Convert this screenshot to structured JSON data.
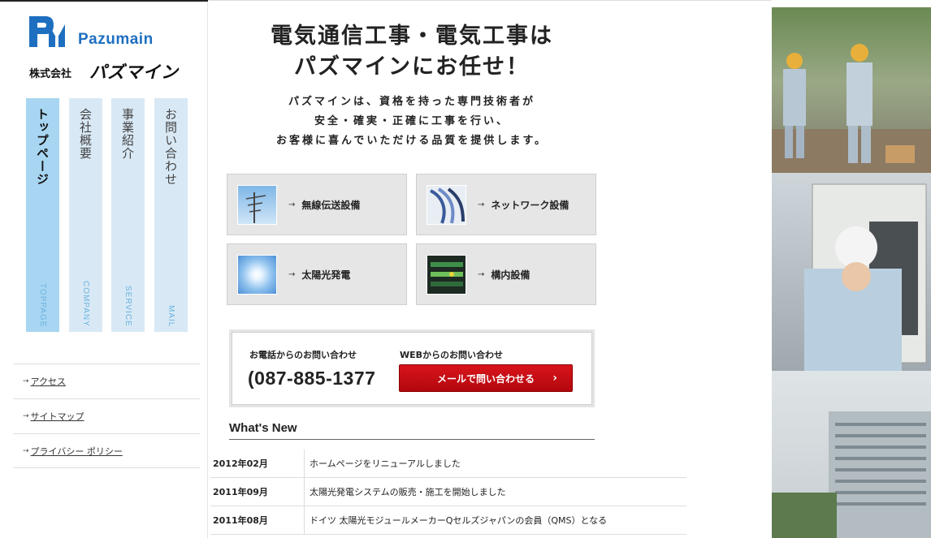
{
  "logo": {
    "en": "Pazumain",
    "jp_small": "株式会社",
    "jp_big": "パズマイン",
    "brand_color": "#1e6fc0"
  },
  "nav": [
    {
      "jp": "トップページ",
      "en": "TOPPAGE",
      "active": true
    },
    {
      "jp": "会社概要",
      "en": "COMPANY",
      "active": false
    },
    {
      "jp": "事業紹介",
      "en": "SERVICE",
      "active": false
    },
    {
      "jp": "お問い合わせ",
      "en": "MAIL",
      "active": false
    }
  ],
  "subnav": [
    {
      "label": "アクセス"
    },
    {
      "label": "サイトマップ"
    },
    {
      "label": "プライバシー ポリシー"
    }
  ],
  "headline": {
    "line1": "電気通信工事・電気工事は",
    "line2": "パズマインにお任せ！"
  },
  "lead": {
    "line1": "パズマインは、資格を持った専門技術者が",
    "line2": "安全・確実・正確に工事を行い、",
    "line3": "お客様に喜んでいただける品質を提供します。"
  },
  "services": [
    {
      "label": "無線伝送設備",
      "icon": "antenna-photo"
    },
    {
      "label": "ネットワーク設備",
      "icon": "cables-photo"
    },
    {
      "label": "太陽光発電",
      "icon": "sun-photo"
    },
    {
      "label": "構内設備",
      "icon": "wiring-photo"
    }
  ],
  "contact": {
    "tel_label": "お電話からのお問い合わせ",
    "tel": "087-885-1377",
    "web_label": "WEBからのお問い合わせ",
    "mail_button": "メールで問い合わせる",
    "button_color": "#c40c14"
  },
  "news": {
    "title": "What's New",
    "items": [
      {
        "date": "2012年02月",
        "text": "ホームページをリニューアルしました"
      },
      {
        "date": "2011年09月",
        "text": "太陽光発電システムの販売・施工を開始しました"
      },
      {
        "date": "2011年08月",
        "text": "ドイツ 太陽光モジュールメーカーQセルズジャパンの会員（QMS）となる"
      }
    ]
  }
}
